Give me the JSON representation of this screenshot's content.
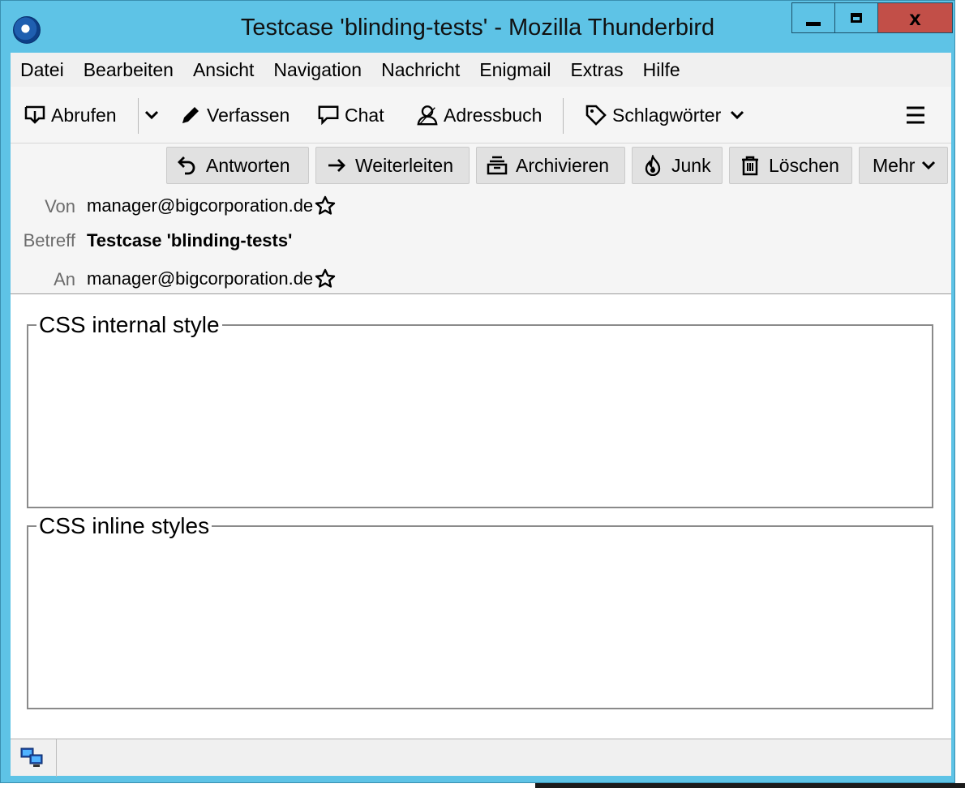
{
  "window": {
    "title": "Testcase 'blinding-tests' - Mozilla Thunderbird",
    "controls": {
      "minimize": "minimize",
      "maximize": "maximize",
      "close": "x"
    }
  },
  "menubar": {
    "items": [
      {
        "label": "Datei"
      },
      {
        "label": "Bearbeiten"
      },
      {
        "label": "Ansicht"
      },
      {
        "label": "Navigation"
      },
      {
        "label": "Nachricht"
      },
      {
        "label": "Enigmail"
      },
      {
        "label": "Extras"
      },
      {
        "label": "Hilfe"
      }
    ]
  },
  "toolbar": {
    "abrufen": "Abrufen",
    "verfassen": "Verfassen",
    "chat": "Chat",
    "adressbuch": "Adressbuch",
    "schlagwoerter": "Schlagwörter"
  },
  "message_actions": {
    "antworten": "Antworten",
    "weiterleiten": "Weiterleiten",
    "archivieren": "Archivieren",
    "junk": "Junk",
    "loeschen": "Löschen",
    "mehr": "Mehr"
  },
  "header": {
    "from_label": "Von",
    "from_value": "manager@bigcorporation.de",
    "subject_label": "Betreff",
    "subject_value": "Testcase 'blinding-tests'",
    "to_label": "An",
    "to_value": "manager@bigcorporation.de"
  },
  "body": {
    "sections": [
      {
        "legend": "CSS internal style"
      },
      {
        "legend": "CSS inline styles"
      }
    ]
  },
  "colors": {
    "titlebar": "#5ec3e6",
    "close_button": "#c24f48",
    "toolbar_bg": "#f5f5f5",
    "menu_bg": "#f0f0f0"
  }
}
